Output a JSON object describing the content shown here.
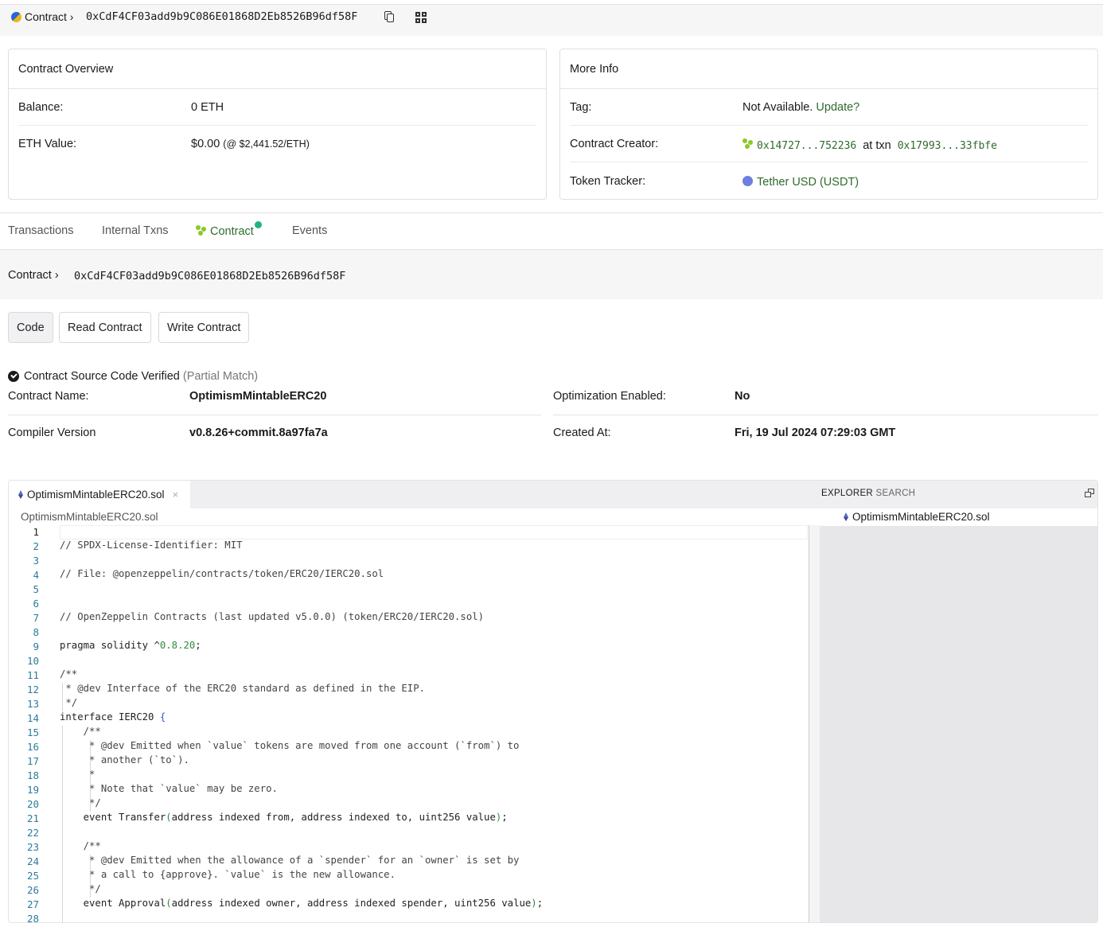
{
  "header": {
    "crumb_label": "Contract ›",
    "address": "0xCdF4CF03add9b9C086E01868D2Eb8526B96df58F"
  },
  "overview": {
    "title": "Contract Overview",
    "balance_label": "Balance:",
    "balance_value": "0 ETH",
    "eth_value_label": "ETH Value:",
    "eth_value": "$0.00",
    "eth_price": "(@ $2,441.52/ETH)"
  },
  "more_info": {
    "title": "More Info",
    "tag_label": "Tag:",
    "tag_value": "Not Available.",
    "tag_update": "Update?",
    "creator_label": "Contract Creator:",
    "creator_address": "0x14727...752236",
    "creator_at_txn": "at txn",
    "creator_txn": "0x17993...33fbfe",
    "tracker_label": "Token Tracker:",
    "tracker_value": "Tether USD (USDT)"
  },
  "tabs": [
    {
      "label": "Transactions"
    },
    {
      "label": "Internal Txns"
    },
    {
      "label": "Contract"
    },
    {
      "label": "Events"
    }
  ],
  "contract_bar": {
    "label": "Contract ›",
    "address": "0xCdF4CF03add9b9C086E01868D2Eb8526B96df58F"
  },
  "buttons": {
    "code": "Code",
    "read": "Read Contract",
    "write": "Write Contract"
  },
  "verification": {
    "text": "Contract Source Code Verified",
    "match": "(Partial Match)",
    "name_label": "Contract Name:",
    "name_value": "OptimismMintableERC20",
    "optimization_label": "Optimization Enabled:",
    "optimization_value": "No",
    "compiler_label": "Compiler Version",
    "compiler_value": "v0.8.26+commit.8a97fa7a",
    "created_label": "Created At:",
    "created_value": "Fri, 19 Jul 2024 07:29:03 GMT"
  },
  "editor": {
    "tab_file": "OptimismMintableERC20.sol",
    "close": "×",
    "explorer_label": "EXPLORER",
    "search_label": "SEARCH",
    "path": "OptimismMintableERC20.sol",
    "side_file": "OptimismMintableERC20.sol",
    "lines": [
      "1",
      "2",
      "3",
      "4",
      "5",
      "6",
      "7",
      "8",
      "9",
      "10",
      "11",
      "12",
      "13",
      "14",
      "15",
      "16",
      "17",
      "18",
      "19",
      "20",
      "21",
      "22",
      "23",
      "24",
      "25",
      "26",
      "27",
      "28"
    ],
    "code": {
      "l2": "// SPDX-License-Identifier: MIT",
      "l4": "// File: @openzeppelin/contracts/token/ERC20/IERC20.sol",
      "l7": "// OpenZeppelin Contracts (last updated v5.0.0) (token/ERC20/IERC20.sol)",
      "l9a": "pragma solidity ^",
      "l9b": "0.8.20",
      "l9c": ";",
      "l11": "/**",
      "l12": " * @dev Interface of the ERC20 standard as defined in the EIP.",
      "l13": " */",
      "l14a": "interface IERC20 ",
      "l14b": "{",
      "l15": "    /**",
      "l16": "     * @dev Emitted when `value` tokens are moved from one account (`from`) to",
      "l17": "     * another (`to`).",
      "l18": "     *",
      "l19": "     * Note that `value` may be zero.",
      "l20": "     */",
      "l21a": "    event Transfer",
      "l21b": "(",
      "l21c": "address indexed from, address indexed to, uint256 value",
      "l21d": ")",
      "l21e": ";",
      "l23": "    /**",
      "l24": "     * @dev Emitted when the allowance of a `spender` for an `owner` is set by",
      "l25": "     * a call to {approve}. `value` is the new allowance.",
      "l26": "     */",
      "l27a": "    event Approval",
      "l27b": "(",
      "l27c": "address indexed owner, address indexed spender, uint256 value",
      "l27d": ")",
      "l27e": ";"
    }
  }
}
